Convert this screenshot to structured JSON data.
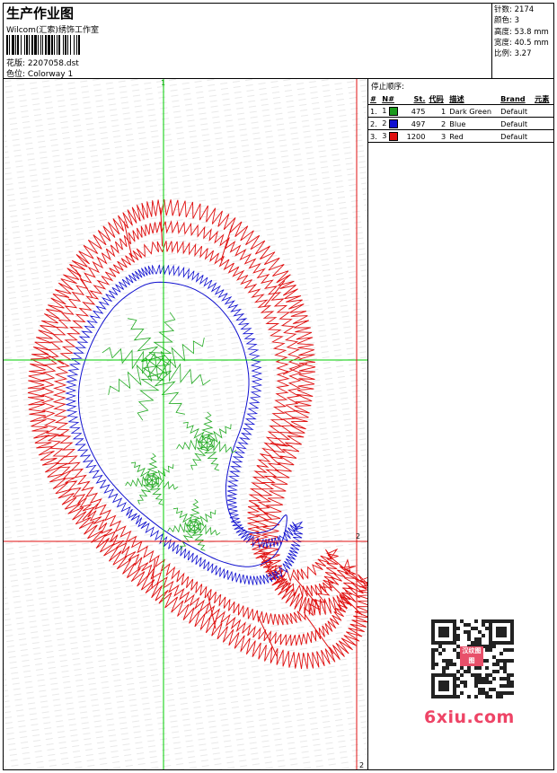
{
  "header": {
    "title": "生产作业图",
    "studio": "Wilcom(汇索)绣饰工作室",
    "design_label": "花版:",
    "design_value": "2207058.dst",
    "colorway_label": "色位:",
    "colorway_value": "Colorway 1"
  },
  "stats": {
    "stitches": "针数: 2174",
    "colors": "颜色: 3",
    "height": "高度: 53.8 mm",
    "width": "宽度: 40.5 mm",
    "scale": "比例: 3.27"
  },
  "stop_sequence": {
    "title": "停止顺序:",
    "columns": [
      "#",
      "N#",
      "St.",
      "代码",
      "描述",
      "Brand",
      "元素"
    ],
    "rows": [
      {
        "idx": "1.",
        "n": "1",
        "st": "475",
        "code": "1",
        "desc": "Dark Green",
        "brand": "Default",
        "color": "#1a9a1a"
      },
      {
        "idx": "2.",
        "n": "2",
        "st": "497",
        "code": "2",
        "desc": "Blue",
        "brand": "Default",
        "color": "#1010d0"
      },
      {
        "idx": "3.",
        "n": "3",
        "st": "1200",
        "code": "3",
        "desc": "Red",
        "brand": "Default",
        "color": "#e01010"
      }
    ]
  },
  "markers": {
    "green_top": "1",
    "red_right": "2",
    "red_bottom": "2"
  },
  "watermark": {
    "logo": "6xiu.com",
    "qr_caption": "汉纹图图"
  },
  "colors": {
    "green": "#22aa22",
    "blue": "#1010d0",
    "red": "#e01010"
  }
}
